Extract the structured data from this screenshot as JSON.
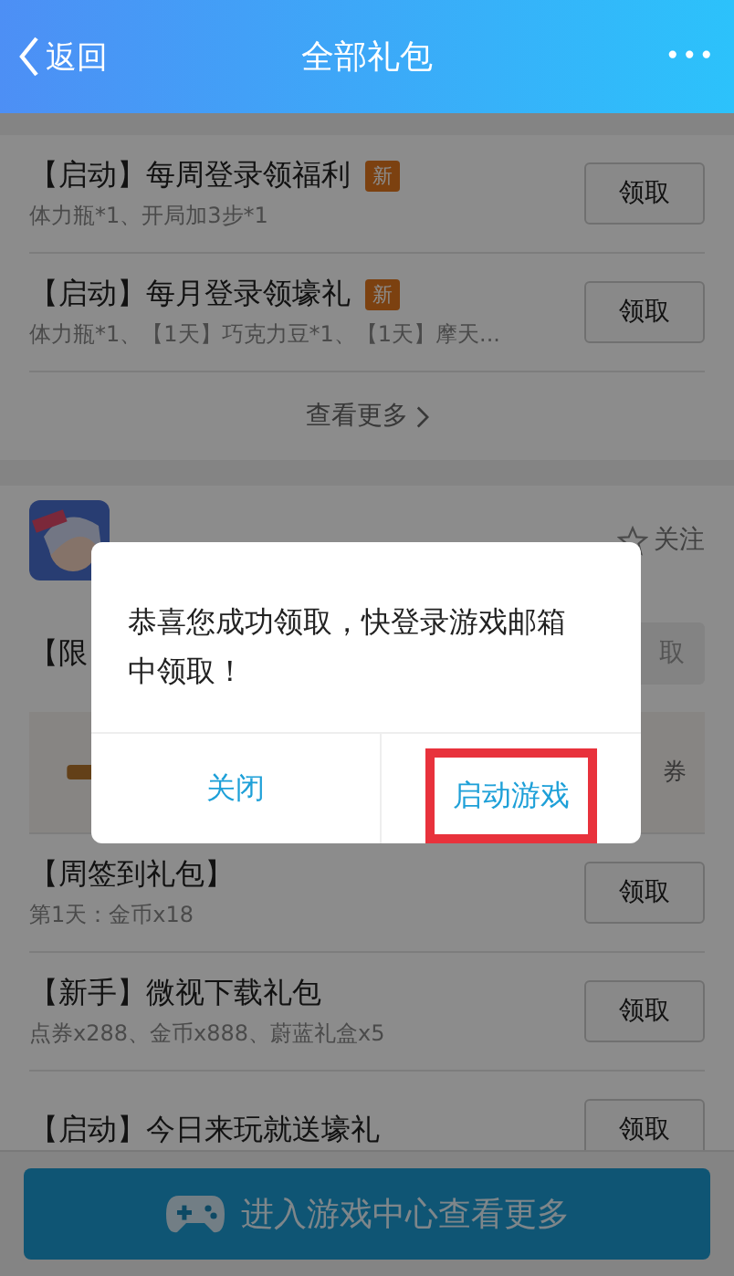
{
  "header": {
    "back": "返回",
    "title": "全部礼包",
    "more": "•••"
  },
  "section1": {
    "gifts": [
      {
        "title": "【启动】每周登录领福利",
        "badge": "新",
        "detail": "体力瓶*1、开局加3步*1",
        "button": "领取"
      },
      {
        "title": "【启动】每月登录领壕礼",
        "badge": "新",
        "detail": "体力瓶*1、【1天】巧克力豆*1、【1天】摩天...",
        "button": "领取"
      }
    ],
    "more": "查看更多"
  },
  "section2": {
    "game": {
      "follow": "关注"
    },
    "limited": {
      "title": "【限",
      "button": "取"
    },
    "banner": {
      "text": "券"
    },
    "gifts": [
      {
        "title": "【周签到礼包】",
        "detail": "第1天：金币x18",
        "button": "领取"
      },
      {
        "title": "【新手】微视下载礼包",
        "detail": "点券x288、金币x888、蔚蓝礼盒x5",
        "button": "领取"
      },
      {
        "title": "【启动】今日来玩就送壕礼",
        "button": "领取"
      }
    ]
  },
  "footer": {
    "button": "进入游戏中心查看更多"
  },
  "dialog": {
    "message": "恭喜您成功领取，快登录游戏邮箱中领取！",
    "buttons": [
      {
        "label": "关闭",
        "highlighted": false
      },
      {
        "label": "启动游戏",
        "highlighted": true
      }
    ]
  }
}
